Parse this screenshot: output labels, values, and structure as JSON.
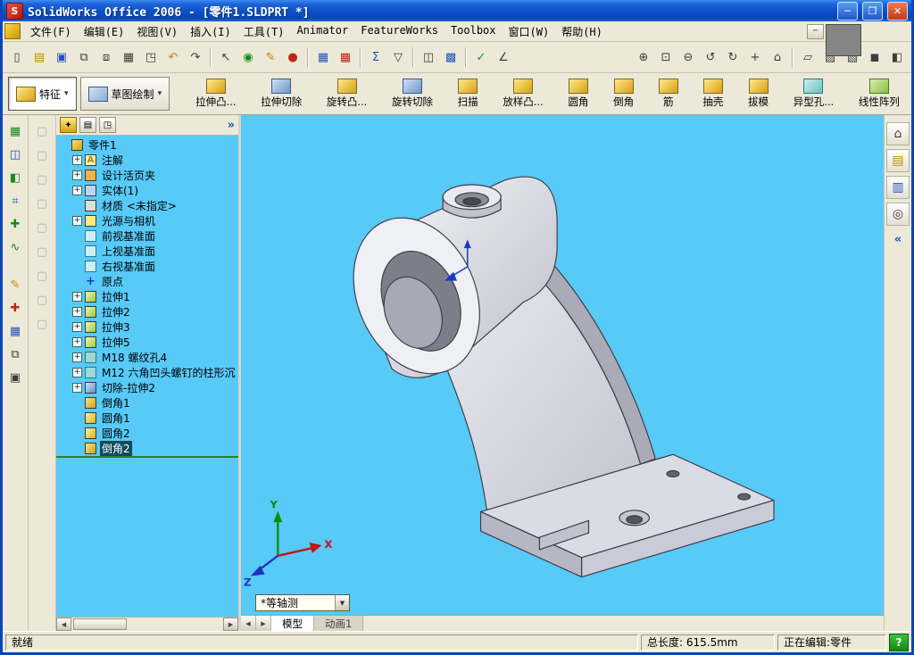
{
  "window": {
    "title": "SolidWorks Office 2006 - [零件1.SLDPRT *]",
    "buttons": {
      "minimize": "─",
      "maximize": "❐",
      "close": "✕"
    }
  },
  "menu": {
    "items": [
      "文件(F)",
      "编辑(E)",
      "视图(V)",
      "插入(I)",
      "工具(T)",
      "Animator",
      "FeatureWorks",
      "Toolbox",
      "窗口(W)",
      "帮助(H)"
    ],
    "mdi_buttons": [
      {
        "name": "mdi-minimize-icon",
        "g": "─"
      },
      {
        "name": "mdi-restore-icon",
        "g": "❐"
      },
      {
        "name": "mdi-close-icon",
        "g": "✕"
      }
    ]
  },
  "toolbar": {
    "group1": [
      {
        "name": "new-icon",
        "g": "▯"
      },
      {
        "name": "open-icon",
        "g": "▤",
        "c": "g"
      },
      {
        "name": "save-icon",
        "g": "▣",
        "c": "b"
      },
      {
        "name": "make-drawing-icon",
        "g": "⧉"
      },
      {
        "name": "make-assembly-icon",
        "g": "⧈"
      },
      {
        "name": "print-icon",
        "g": "▦"
      },
      {
        "name": "print-preview-icon",
        "g": "◳"
      },
      {
        "name": "undo-icon",
        "g": "↶",
        "c": "g"
      },
      {
        "name": "redo-icon",
        "g": "↷"
      }
    ],
    "group2": [
      {
        "name": "select-icon",
        "g": "↖"
      },
      {
        "name": "rebuild-icon",
        "g": "◉",
        "c": "gr"
      },
      {
        "name": "sketch-icon",
        "g": "✎",
        "c": "g"
      },
      {
        "name": "color-icon",
        "g": "●",
        "c": "r"
      }
    ],
    "group3": [
      {
        "name": "grid-icon",
        "g": "▦",
        "c": "b"
      },
      {
        "name": "design-table-icon",
        "g": "▦",
        "c": "r"
      }
    ],
    "group4": [
      {
        "name": "equations-icon",
        "g": "Σ",
        "c": "b"
      },
      {
        "name": "selection-filter-icon",
        "g": "▽"
      }
    ],
    "group5": [
      {
        "name": "screen-capture-icon",
        "g": "◫"
      },
      {
        "name": "display-settings-icon",
        "g": "▩",
        "c": "b"
      }
    ],
    "group6": [
      {
        "name": "geometry-check-icon",
        "g": "✓",
        "c": "gr"
      },
      {
        "name": "measure-icon",
        "g": "∠"
      }
    ],
    "group7": [
      {
        "name": "zoom-fit-icon",
        "g": "⊕"
      },
      {
        "name": "zoom-area-icon",
        "g": "⊡"
      },
      {
        "name": "zoom-in-out-icon",
        "g": "⊖"
      },
      {
        "name": "previous-view-icon",
        "g": "↺"
      },
      {
        "name": "rotate-view-icon",
        "g": "↻"
      },
      {
        "name": "pan-icon",
        "g": "+"
      },
      {
        "name": "standard-views-icon",
        "g": "⌂"
      }
    ],
    "group8": [
      {
        "name": "wireframe-icon",
        "g": "▱"
      },
      {
        "name": "hidden-lines-visible-icon",
        "g": "▨"
      },
      {
        "name": "hidden-lines-removed-icon",
        "g": "▧"
      },
      {
        "name": "shaded-icon",
        "g": "◼"
      },
      {
        "name": "section-view-icon",
        "g": "◧"
      }
    ]
  },
  "command_manager": {
    "caret": "▾",
    "tabs": [
      {
        "label": "特征",
        "icon": "features"
      },
      {
        "label": "草图绘制",
        "icon": "sketch"
      }
    ],
    "buttons": [
      {
        "label": "拉伸凸...",
        "icon": "boss-extrude"
      },
      {
        "label": "拉伸切除",
        "icon": "extruded-cut"
      },
      {
        "label": "旋转凸...",
        "icon": "revolved-boss"
      },
      {
        "label": "旋转切除",
        "icon": "revolved-cut"
      },
      {
        "label": "扫描",
        "icon": "sweep"
      },
      {
        "label": "放样凸...",
        "icon": "loft"
      },
      {
        "label": "圆角",
        "icon": "fillet"
      },
      {
        "label": "倒角",
        "icon": "chamfer"
      },
      {
        "label": "筋",
        "icon": "rib"
      },
      {
        "label": "抽壳",
        "icon": "shell"
      },
      {
        "label": "拔模",
        "icon": "draft"
      },
      {
        "label": "异型孔...",
        "icon": "hole-wizard"
      },
      {
        "label": "线性阵列",
        "icon": "linear-pattern"
      }
    ]
  },
  "left_tools": {
    "group1": [
      {
        "name": "rectangle-tool-icon",
        "g": "▦",
        "c": "gr"
      },
      {
        "name": "cylinder-tool-icon",
        "g": "◫",
        "c": "b"
      },
      {
        "name": "corner-tool-icon",
        "g": "◧",
        "c": "gr"
      },
      {
        "name": "plane-tool-icon",
        "g": "⌗",
        "c": "b"
      },
      {
        "name": "axis-tool-icon",
        "g": "✚",
        "c": "gr"
      },
      {
        "name": "spline-tool-icon",
        "g": "∿",
        "c": "gr"
      }
    ],
    "group2": [
      {
        "name": "annotate-tool-icon",
        "g": "✎",
        "c": "g"
      },
      {
        "name": "check-tool-icon",
        "g": "✚",
        "c": "r"
      },
      {
        "name": "grid-tool-icon",
        "g": "▦",
        "c": "b"
      },
      {
        "name": "layers-tool-icon",
        "g": "⧉"
      },
      {
        "name": "box-tool-icon",
        "g": "▣"
      }
    ],
    "disabled": [
      {
        "name": "disabled-tool-icon",
        "g": "▢",
        "c": "dis"
      },
      {
        "name": "disabled-tool-icon",
        "g": "▢",
        "c": "dis"
      },
      {
        "name": "disabled-tool-icon",
        "g": "▢",
        "c": "dis"
      },
      {
        "name": "disabled-tool-icon",
        "g": "▢",
        "c": "dis"
      },
      {
        "name": "disabled-tool-icon",
        "g": "▢",
        "c": "dis"
      },
      {
        "name": "disabled-tool-icon",
        "g": "▢",
        "c": "dis"
      },
      {
        "name": "disabled-tool-icon",
        "g": "▢",
        "c": "dis"
      },
      {
        "name": "disabled-tool-icon",
        "g": "▢",
        "c": "dis"
      },
      {
        "name": "disabled-tool-icon",
        "g": "▢",
        "c": "dis"
      }
    ]
  },
  "tree": {
    "header_icons": [
      {
        "name": "featuremanager-tab-icon",
        "g": "✦"
      },
      {
        "name": "propertymanager-tab-icon",
        "g": "▤"
      },
      {
        "name": "configurationmanager-tab-icon",
        "g": "◳"
      }
    ],
    "collapse": "»",
    "items": [
      {
        "label": "零件1",
        "icon": "part",
        "glyph": "",
        "exp": "",
        "lvl": "0"
      },
      {
        "label": "注解",
        "icon": "annotations",
        "glyph": "A",
        "exp": "+",
        "lvl": "1"
      },
      {
        "label": "设计活页夹",
        "icon": "design-binder",
        "glyph": "",
        "exp": "+",
        "lvl": "1"
      },
      {
        "label": "实体(1)",
        "icon": "solid-bodies-folder",
        "glyph": "",
        "exp": "+",
        "lvl": "1"
      },
      {
        "label": "材质 <未指定>",
        "icon": "material",
        "glyph": "",
        "exp": "",
        "lvl": "1"
      },
      {
        "label": "光源与相机",
        "icon": "lights-cameras",
        "glyph": "",
        "exp": "+",
        "lvl": "1"
      },
      {
        "label": "前视基准面",
        "icon": "plane",
        "glyph": "",
        "exp": "",
        "lvl": "1"
      },
      {
        "label": "上视基准面",
        "icon": "plane",
        "glyph": "",
        "exp": "",
        "lvl": "1"
      },
      {
        "label": "右视基准面",
        "icon": "plane",
        "glyph": "",
        "exp": "",
        "lvl": "1"
      },
      {
        "label": "原点",
        "icon": "origin",
        "glyph": "+",
        "exp": "",
        "lvl": "1"
      },
      {
        "label": "拉伸1",
        "icon": "boss-extrude",
        "glyph": "",
        "exp": "+",
        "lvl": "1"
      },
      {
        "label": "拉伸2",
        "icon": "boss-extrude",
        "glyph": "",
        "exp": "+",
        "lvl": "1"
      },
      {
        "label": "拉伸3",
        "icon": "boss-extrude",
        "glyph": "",
        "exp": "+",
        "lvl": "1"
      },
      {
        "label": "拉伸5",
        "icon": "boss-extrude",
        "glyph": "",
        "exp": "+",
        "lvl": "1"
      },
      {
        "label": "M18 螺纹孔4",
        "icon": "hole-wizard",
        "glyph": "",
        "exp": "+",
        "lvl": "1"
      },
      {
        "label": "M12 六角凹头螺钉的柱形沉",
        "icon": "hole-wizard",
        "glyph": "",
        "exp": "+",
        "lvl": "1"
      },
      {
        "label": "切除-拉伸2",
        "icon": "cut-extrude",
        "glyph": "",
        "exp": "+",
        "lvl": "1"
      },
      {
        "label": "倒角1",
        "icon": "chamfer",
        "glyph": "",
        "exp": "",
        "lvl": "1"
      },
      {
        "label": "圆角1",
        "icon": "fillet",
        "glyph": "",
        "exp": "",
        "lvl": "1"
      },
      {
        "label": "圆角2",
        "icon": "fillet",
        "glyph": "",
        "exp": "",
        "lvl": "1"
      },
      {
        "label": "倒角2",
        "icon": "chamfer",
        "glyph": "",
        "exp": "",
        "lvl": "1",
        "sel": "1"
      }
    ]
  },
  "viewport": {
    "view_label": "*等轴测",
    "dropdown": "▼",
    "nav": [
      {
        "name": "tab-scroll-left-icon",
        "g": "◀"
      },
      {
        "name": "tab-scroll-right-icon",
        "g": "▶"
      }
    ],
    "tabs": [
      "模型",
      "动画1"
    ],
    "triad": {
      "x": "X",
      "y": "Y",
      "z": "Z"
    }
  },
  "task_pane": {
    "icons": [
      {
        "name": "solidworks-resources-icon",
        "g": "⌂"
      },
      {
        "name": "design-library-icon",
        "g": "▤",
        "c": "g"
      },
      {
        "name": "file-explorer-icon",
        "g": "▥",
        "c": "b"
      },
      {
        "name": "search-icon",
        "g": "◎"
      }
    ],
    "chevron": "«"
  },
  "status": {
    "ready": "就绪",
    "length": "总长度: 615.5mm",
    "editing": "正在编辑:零件",
    "help": "?"
  }
}
